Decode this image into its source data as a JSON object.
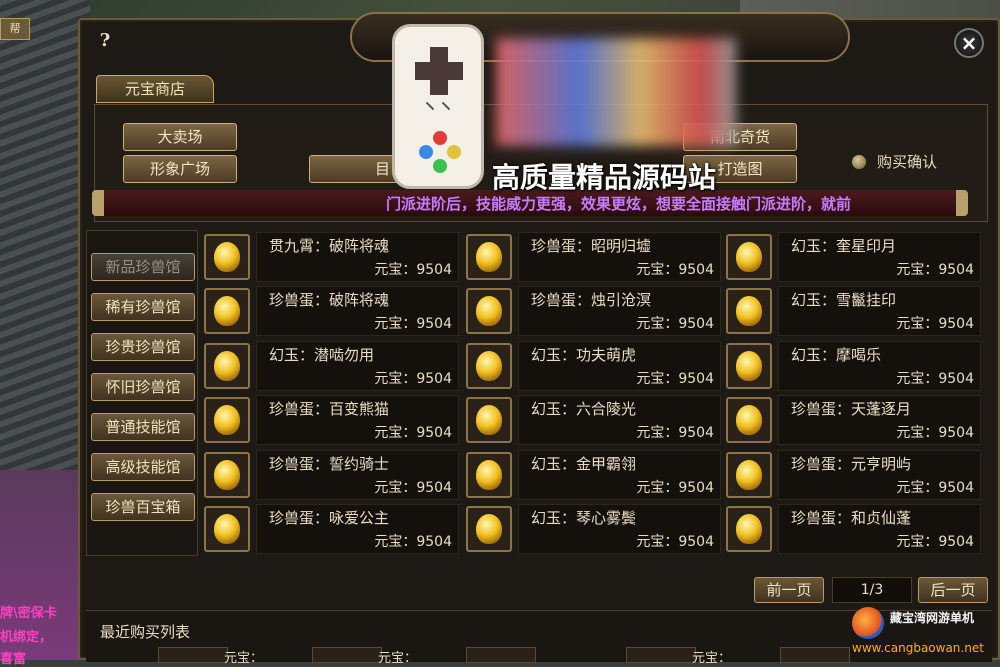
{
  "window": {
    "help": "?",
    "close": "×"
  },
  "background": {
    "tab": "帮",
    "side_lines": [
      "牌\\密保卡",
      "机绑定，",
      "   喜富 "
    ]
  },
  "shop_tab": "元宝商店",
  "top_buttons": {
    "auction": "大卖场",
    "image_plaza": "形象广场",
    "north_south": "南北奇货",
    "forge": "打造图",
    "hidden_label": "目"
  },
  "confirm": {
    "label": "购买确认"
  },
  "marquee": "门派进阶后，技能威力更强，效果更炫，想要全面接触门派进阶，就前",
  "logo": {
    "text": "高质量精品源码站"
  },
  "categories": [
    {
      "label": "新品珍兽馆",
      "disabled": true
    },
    {
      "label": "稀有珍兽馆"
    },
    {
      "label": "珍贵珍兽馆"
    },
    {
      "label": "怀旧珍兽馆"
    },
    {
      "label": "普通技能馆"
    },
    {
      "label": "高级技能馆"
    },
    {
      "label": "珍兽百宝箱"
    }
  ],
  "items": [
    {
      "name": "贯九霄：破阵将魂",
      "price": "元宝：9504"
    },
    {
      "name": "珍兽蛋：昭明归墟",
      "price": "元宝：9504"
    },
    {
      "name": "幻玉：奎星印月",
      "price": "元宝：9504"
    },
    {
      "name": "珍兽蛋：破阵将魂",
      "price": "元宝：9504"
    },
    {
      "name": "珍兽蛋：烛引沧溟",
      "price": "元宝：9504"
    },
    {
      "name": "幻玉：雪鬣挂印",
      "price": "元宝：9504"
    },
    {
      "name": "幻玉：潜啮勿用",
      "price": "元宝：9504"
    },
    {
      "name": "幻玉：功夫萌虎",
      "price": "元宝：9504"
    },
    {
      "name": "幻玉：摩喝乐",
      "price": "元宝：9504"
    },
    {
      "name": "珍兽蛋：百变熊猫",
      "price": "元宝：9504"
    },
    {
      "name": "幻玉：六合陵光",
      "price": "元宝：9504"
    },
    {
      "name": "珍兽蛋：天蓬逐月",
      "price": "元宝：9504"
    },
    {
      "name": "珍兽蛋：誓约骑士",
      "price": "元宝：9504"
    },
    {
      "name": "幻玉：金甲霸翎",
      "price": "元宝：9504"
    },
    {
      "name": "珍兽蛋：元亨明屿",
      "price": "元宝：9504"
    },
    {
      "name": "珍兽蛋：咏爱公主",
      "price": "元宝：9504"
    },
    {
      "name": "幻玉：琴心雾鬓",
      "price": "元宝：9504"
    },
    {
      "name": "珍兽蛋：和贞仙蓬",
      "price": "元宝：9504"
    }
  ],
  "pager": {
    "prev": "前一页",
    "page": "1/3",
    "next": "后一页"
  },
  "recent": {
    "title": "最近购买列表",
    "price_label": "元宝："
  },
  "watermark": {
    "text": "藏宝湾网游单机",
    "url": "www.cangbaowan.net"
  }
}
